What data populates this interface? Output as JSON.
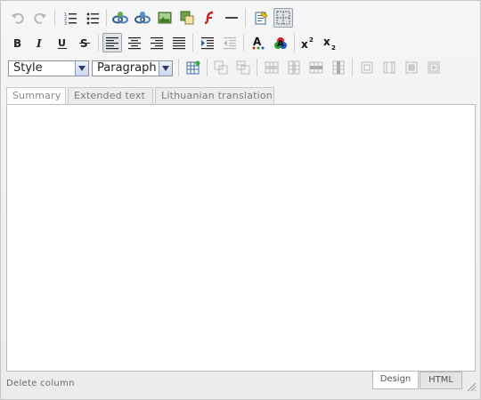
{
  "toolbar": {
    "row1": [
      "undo-icon",
      "redo-icon",
      "numbered-list-icon",
      "bullet-list-icon",
      "insert-link-icon",
      "remove-link-icon",
      "insert-image-icon",
      "image-manager-icon",
      "insert-flash-icon",
      "horizontal-rule-icon",
      "paste-from-word-icon",
      "toggle-guidelines-icon"
    ],
    "row2": [
      "bold-icon",
      "italic-icon",
      "underline-icon",
      "strikethrough-icon",
      "align-left-icon",
      "align-center-icon",
      "align-right-icon",
      "justify-icon",
      "indent-icon",
      "outdent-icon",
      "text-color-icon",
      "highlight-color-icon",
      "superscript-icon",
      "subscript-icon"
    ],
    "row3": [
      "insert-table-icon",
      "table-cell-props-icon",
      "table-row-props-icon",
      "insert-row-above-icon",
      "insert-column-before-icon",
      "insert-row-below-icon",
      "delete-row-icon",
      "delete-column-icon",
      "split-cell-icon",
      "merge-cells-icon",
      "table-props-icon",
      "cell-props-icon"
    ]
  },
  "style_select": {
    "value": "Style"
  },
  "format_select": {
    "value": "Paragraph"
  },
  "tabs": [
    {
      "label": "Summary"
    },
    {
      "label": "Extended text"
    },
    {
      "label": "Lithuanian translation"
    }
  ],
  "status": {
    "text": "Delete column"
  },
  "modes": {
    "design": "Design",
    "html": "HTML"
  },
  "colors": {
    "accent": "#9aa1a8",
    "flash_red": "#d42020",
    "background": "#f0f0f0"
  }
}
